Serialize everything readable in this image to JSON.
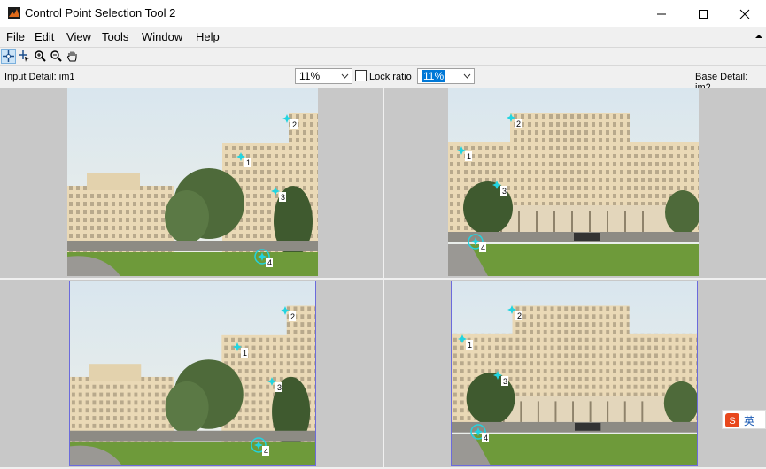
{
  "window": {
    "title": "Control Point Selection Tool 2"
  },
  "menu": [
    "File",
    "Edit",
    "View",
    "Tools",
    "Window",
    "Help"
  ],
  "menu_mnemonic": [
    "F",
    "E",
    "V",
    "T",
    "W",
    "H"
  ],
  "detail": {
    "input_label": "Input Detail: im1",
    "zoom_value": "11%",
    "lock_ratio_label": "Lock ratio",
    "zoom_value_2": "11%",
    "base_label": "Base Detail: im2"
  },
  "control_points": [
    "1",
    "2",
    "3",
    "4"
  ],
  "ime": {
    "label": "英"
  },
  "colors": {
    "marker": "#22d4e0",
    "selection": "#6b6bdc",
    "panel_bg": "#c8c8c8",
    "highlight": "#0078d7"
  }
}
